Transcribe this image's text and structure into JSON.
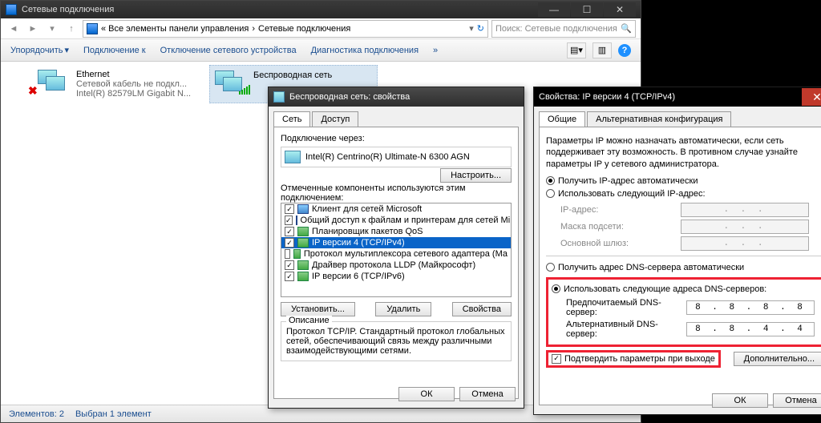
{
  "explorer": {
    "title": "Сетевые подключения",
    "breadcrumb_prefix": "« Все элементы панели управления",
    "breadcrumb_sep": "›",
    "breadcrumb_last": "Сетевые подключения",
    "search_placeholder": "Поиск: Сетевые подключения",
    "toolbar": {
      "organize": "Упорядочить",
      "connect": "Подключение к",
      "disable": "Отключение сетевого устройства",
      "diagnose": "Диагностика подключения"
    },
    "items": {
      "ethernet": {
        "title": "Ethernet",
        "sub1": "Сетевой кабель не подкл...",
        "sub2": "Intel(R) 82579LM Gigabit N..."
      },
      "wlan": {
        "title": "Беспроводная сеть"
      }
    },
    "status": {
      "count": "Элементов: 2",
      "selected": "Выбран 1 элемент"
    }
  },
  "props": {
    "title": "Беспроводная сеть: свойства",
    "tabs": {
      "net": "Сеть",
      "access": "Доступ"
    },
    "connect_via": "Подключение через:",
    "adapter": "Intel(R) Centrino(R) Ultimate-N 6300 AGN",
    "configure": "Настроить...",
    "components_label": "Отмеченные компоненты используются этим подключением:",
    "components": [
      "Клиент для сетей Microsoft",
      "Общий доступ к файлам и принтерам для сетей Mi",
      "Планировщик пакетов QoS",
      "IP версии 4 (TCP/IPv4)",
      "Протокол мультиплексора сетевого адаптера (Ма",
      "Драйвер протокола LLDP (Майкрософт)",
      "IP версии 6 (TCP/IPv6)"
    ],
    "install": "Установить...",
    "uninstall": "Удалить",
    "properties": "Свойства",
    "desc_label": "Описание",
    "desc": "Протокол TCP/IP. Стандартный протокол глобальных сетей, обеспечивающий связь между различными взаимодействующими сетями.",
    "ok": "ОК",
    "cancel": "Отмена"
  },
  "ipv4": {
    "title": "Свойства: IP версии 4 (TCP/IPv4)",
    "tabs": {
      "general": "Общие",
      "alt": "Альтернативная конфигурация"
    },
    "info": "Параметры IP можно назначать автоматически, если сеть поддерживает эту возможность. В противном случае узнайте параметры IP у сетевого администратора.",
    "ip_auto": "Получить IP-адрес автоматически",
    "ip_manual": "Использовать следующий IP-адрес:",
    "ip_addr": "IP-адрес:",
    "mask": "Маска подсети:",
    "gateway": "Основной шлюз:",
    "dns_auto": "Получить адрес DNS-сервера автоматически",
    "dns_manual": "Использовать следующие адреса DNS-серверов:",
    "dns_pref": "Предпочитаемый DNS-сервер:",
    "dns_alt": "Альтернативный DNS-сервер:",
    "dns_pref_val": "8 . 8 . 8 . 8",
    "dns_alt_val": "8 . 8 . 4 . 4",
    "validate": "Подтвердить параметры при выходе",
    "advanced": "Дополнительно...",
    "ok": "ОК",
    "cancel": "Отмена",
    "dots": ".   .   ."
  }
}
